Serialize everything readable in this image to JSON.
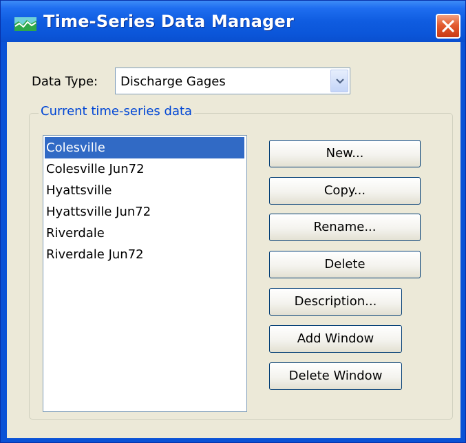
{
  "window": {
    "title": "Time-Series Data Manager",
    "icon": "hydrograph-app-icon",
    "close_icon": "close-icon"
  },
  "data_type": {
    "label": "Data Type:",
    "selected": "Discharge Gages"
  },
  "group": {
    "title": "Current time-series data"
  },
  "list": {
    "items": [
      {
        "label": "Colesville",
        "selected": true
      },
      {
        "label": "Colesville Jun72",
        "selected": false
      },
      {
        "label": "Hyattsville",
        "selected": false
      },
      {
        "label": "Hyattsville Jun72",
        "selected": false
      },
      {
        "label": "Riverdale",
        "selected": false
      },
      {
        "label": "Riverdale Jun72",
        "selected": false
      }
    ]
  },
  "buttons": {
    "new": "New...",
    "copy": "Copy...",
    "rename": "Rename...",
    "delete": "Delete",
    "description": "Description...",
    "add_window": "Add Window",
    "delete_window": "Delete Window"
  },
  "colors": {
    "titlebar": "#0a52d6",
    "client_bg": "#ece9d8",
    "group_title": "#0046d5",
    "selection": "#316ac5",
    "close_button": "#e35b2f"
  }
}
